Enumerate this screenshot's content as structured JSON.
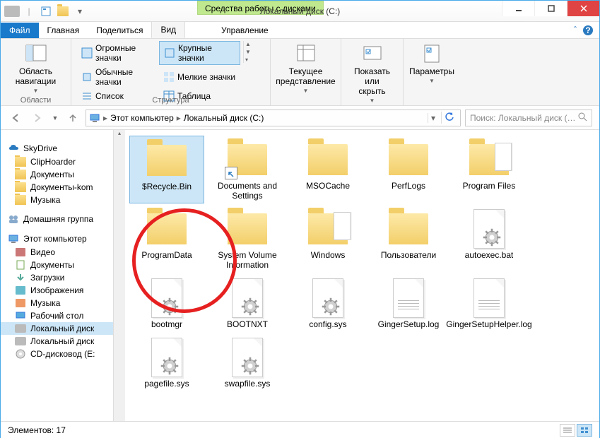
{
  "title": "Локальный диск (C:)",
  "disc_tools": "Средства работы с дисками",
  "tabs": {
    "file": "Файл",
    "home": "Главная",
    "share": "Поделиться",
    "view": "Вид",
    "manage": "Управление"
  },
  "ribbon": {
    "nav_area": {
      "label": "Область навигации",
      "group": "Области"
    },
    "views": {
      "huge": "Огромные значки",
      "large": "Крупные значки",
      "normal": "Обычные значки",
      "small": "Мелкие значки",
      "list": "Список",
      "table": "Таблица",
      "group": "Структура"
    },
    "current_view": {
      "label": "Текущее представление"
    },
    "show_hide": {
      "label": "Показать или скрыть"
    },
    "options": {
      "label": "Параметры"
    }
  },
  "breadcrumb": {
    "pc": "Этот компьютер",
    "loc": "Локальный диск (C:)"
  },
  "search_placeholder": "Поиск: Локальный диск (C:)",
  "sidebar": {
    "s0": "SkyDrive",
    "s1": "ClipHoarder",
    "s2": "Документы",
    "s3": "Документы-kom",
    "s4": "Музыка",
    "h1": "Домашняя группа",
    "h2": "Этот компьютер",
    "c0": "Видео",
    "c1": "Документы",
    "c2": "Загрузки",
    "c3": "Изображения",
    "c4": "Музыка",
    "c5": "Рабочий стол",
    "c6": "Локальный диск",
    "c7": "Локальный диск",
    "c8": "CD-дисковод (E:"
  },
  "items": [
    {
      "n": "$Recycle.Bin",
      "t": "folder"
    },
    {
      "n": "Documents and Settings",
      "t": "shortcut"
    },
    {
      "n": "MSOCache",
      "t": "folder"
    },
    {
      "n": "PerfLogs",
      "t": "folder"
    },
    {
      "n": "Program Files",
      "t": "folder-docs"
    },
    {
      "n": "ProgramData",
      "t": "folder"
    },
    {
      "n": "System Volume Information",
      "t": "folder"
    },
    {
      "n": "Windows",
      "t": "folder-docs"
    },
    {
      "n": "Пользователи",
      "t": "folder"
    },
    {
      "n": "autoexec.bat",
      "t": "sysfile"
    },
    {
      "n": "bootmgr",
      "t": "sysfile"
    },
    {
      "n": "BOOTNXT",
      "t": "sysfile"
    },
    {
      "n": "config.sys",
      "t": "sysfile"
    },
    {
      "n": "GingerSetup.log",
      "t": "log"
    },
    {
      "n": "GingerSetupHelper.log",
      "t": "log"
    },
    {
      "n": "pagefile.sys",
      "t": "sysfile"
    },
    {
      "n": "swapfile.sys",
      "t": "sysfile"
    }
  ],
  "status": "Элементов: 17"
}
